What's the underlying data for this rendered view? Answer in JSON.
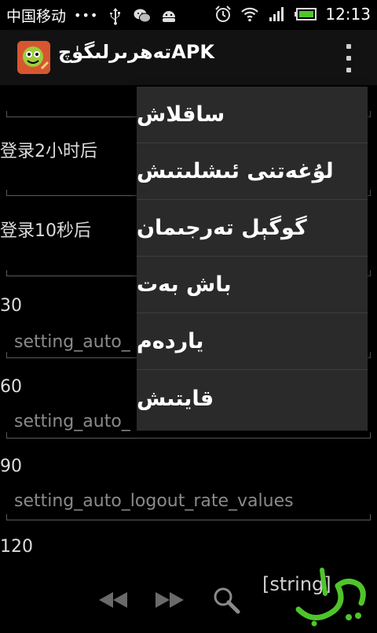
{
  "statusbar": {
    "carrier": "中国移动",
    "dots": "•••",
    "time": "12:13"
  },
  "actionbar": {
    "title": "تەھرىرلىگۈچAPK"
  },
  "list": {
    "rows": [
      {
        "label": "登录2小时后"
      },
      {
        "label": "登录10秒后"
      },
      {
        "label": "30",
        "hint": "setting_auto_"
      },
      {
        "label": "60",
        "hint": "setting_auto_"
      },
      {
        "label": "90",
        "hint": "setting_auto_logout_rate_values"
      },
      {
        "label": "120"
      }
    ]
  },
  "menu": {
    "items": [
      "ساقلاش",
      "لۇغەتنى ئىشلىتىش",
      "گوگېل تەرجىمان",
      "باش بەت",
      "ياردەم",
      "قايتىش"
    ]
  },
  "bottom": {
    "string_text": "[string]"
  },
  "colors": {
    "background": "#000000",
    "menu_bg": "#2a2a2a",
    "accent_green": "#4fc42b",
    "app_icon": "#d2452c"
  },
  "icons": [
    "usb-icon",
    "wechat-icon",
    "android-icon",
    "alarm-icon",
    "wifi-icon",
    "signal-icon",
    "battery-icon",
    "overflow-icon",
    "rewind-icon",
    "fast-forward-icon",
    "search-icon"
  ]
}
